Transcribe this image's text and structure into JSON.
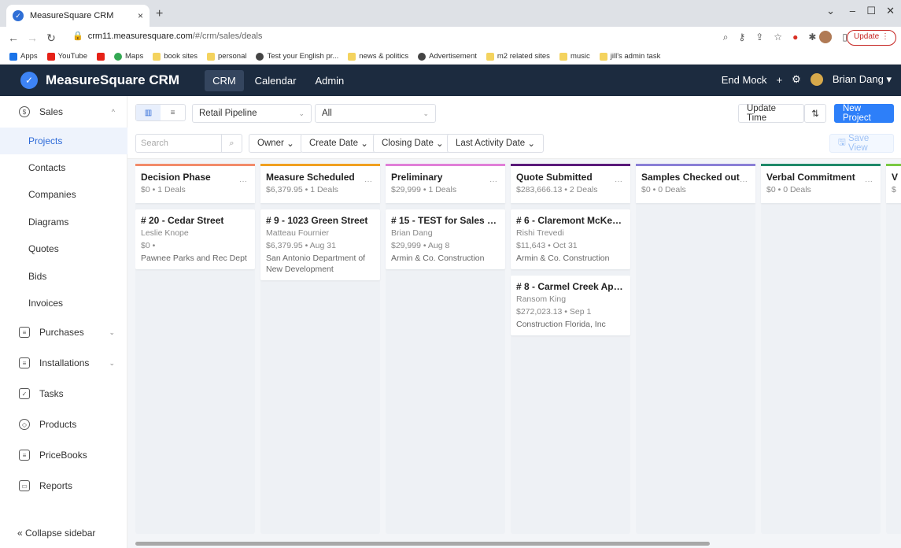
{
  "browser": {
    "tab_title": "MeasureSquare CRM",
    "tab_close": "×",
    "new_tab": "+",
    "url_host": "crm11.measuresquare.com",
    "url_path": "/#/crm/sales/deals",
    "update_label": "Update",
    "bookmarks": [
      "Apps",
      "YouTube",
      "Maps",
      "book sites",
      "personal",
      "Test your English pr...",
      "news & politics",
      "Advertisement",
      "m2 related sites",
      "music",
      "jill's admin task"
    ]
  },
  "header": {
    "app_name": "MeasureSquare CRM",
    "nav": [
      "CRM",
      "Calendar",
      "Admin"
    ],
    "end_mock": "End Mock",
    "plus": "+",
    "user": "Brian Dang"
  },
  "sidebar": {
    "items": [
      {
        "label": "Sales"
      },
      {
        "label": "Projects"
      },
      {
        "label": "Contacts"
      },
      {
        "label": "Companies"
      },
      {
        "label": "Diagrams"
      },
      {
        "label": "Quotes"
      },
      {
        "label": "Bids"
      },
      {
        "label": "Invoices"
      },
      {
        "label": "Purchases"
      },
      {
        "label": "Installations"
      },
      {
        "label": "Tasks"
      },
      {
        "label": "Products"
      },
      {
        "label": "PriceBooks"
      },
      {
        "label": "Reports"
      }
    ],
    "collapse": "« Collapse sidebar"
  },
  "toolbar": {
    "pipeline": "Retail Pipeline",
    "filter_all": "All",
    "update_time": "Update Time",
    "new_project": "New Project",
    "search_placeholder": "Search",
    "owner": "Owner",
    "create_date": "Create Date",
    "closing_date": "Closing Date",
    "last_activity_date": "Last Activity Date",
    "save_view": "Save View"
  },
  "columns": [
    {
      "title": "Decision Phase",
      "summary": "$0 • 1 Deals",
      "color": "#f28b6a",
      "cards": [
        {
          "title": "# 20 - Cedar Street",
          "person": "Leslie Knope",
          "amount": "$0 •",
          "company": "Pawnee Parks and Rec Dept"
        }
      ]
    },
    {
      "title": "Measure Scheduled",
      "summary": "$6,379.95 • 1 Deals",
      "color": "#f0a020",
      "cards": [
        {
          "title": "# 9 - 1023 Green Street",
          "person": "Matteau Fournier",
          "amount": "$6,379.95 • Aug 31",
          "company": "San Antonio Department of New Development"
        }
      ]
    },
    {
      "title": "Preliminary",
      "summary": "$29,999 • 1 Deals",
      "color": "#e07fd8",
      "cards": [
        {
          "title": "# 15 - TEST for Sales - R...",
          "person": "Brian Dang",
          "amount": "$29,999 • Aug 8",
          "company": "Armin & Co. Construction"
        }
      ]
    },
    {
      "title": "Quote Submitted",
      "summary": "$283,666.13 • 2 Deals",
      "color": "#5a1a7a",
      "cards": [
        {
          "title": "# 6 - Claremont McKen...",
          "person": "Rishi Trevedi",
          "amount": "$11,643 • Oct 31",
          "company": "Armin & Co. Construction"
        },
        {
          "title": "# 8 - Carmel Creek Apar...",
          "person": "Ransom King",
          "amount": "$272,023.13 • Sep 1",
          "company": "Construction Florida, Inc"
        }
      ]
    },
    {
      "title": "Samples Checked out",
      "summary": "$0 • 0 Deals",
      "color": "#8a7fd6",
      "cards": []
    },
    {
      "title": "Verbal Commitment",
      "summary": "$0 • 0 Deals",
      "color": "#1f8a6a",
      "cards": []
    },
    {
      "title": "V",
      "summary": "$",
      "color": "#7ac943",
      "cards": []
    }
  ]
}
